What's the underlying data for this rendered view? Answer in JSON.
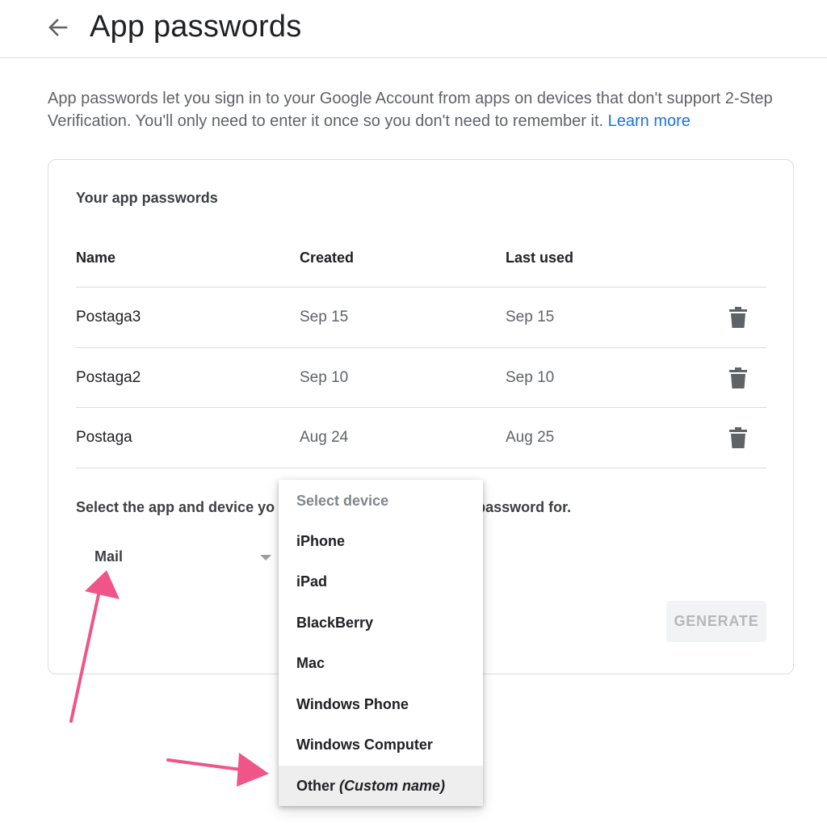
{
  "header": {
    "title": "App passwords",
    "back_icon": "arrow-back-icon"
  },
  "intro": {
    "text": "App passwords let you sign in to your Google Account from apps on devices that don't support 2-Step Verification. You'll only need to enter it once so you don't need to remember it. ",
    "link": "Learn more",
    "link_color": "#1a73e8"
  },
  "card": {
    "title": "Your app passwords",
    "columns": [
      "Name",
      "Created",
      "Last used"
    ],
    "rows": [
      {
        "name": "Postaga3",
        "created": "Sep 15",
        "last_used": "Sep 15",
        "action_icon": "trash-icon"
      },
      {
        "name": "Postaga2",
        "created": "Sep 10",
        "last_used": "Sep 10",
        "action_icon": "trash-icon"
      },
      {
        "name": "Postaga",
        "created": "Aug 24",
        "last_used": "Aug 25",
        "action_icon": "trash-icon"
      }
    ],
    "select_label_left": "Select the app and device yo",
    "select_label_right": "password for.",
    "app_select": {
      "value": "Mail"
    },
    "generate_label": "GENERATE"
  },
  "device_dropdown": {
    "placeholder": "Select device",
    "options": [
      "iPhone",
      "iPad",
      "BlackBerry",
      "Mac",
      "Windows Phone",
      "Windows Computer"
    ],
    "other_label": "Other",
    "other_hint": "(Custom name)",
    "highlighted_option": "Other (Custom name)"
  },
  "annotations": {
    "arrow_color": "#f0558a"
  }
}
